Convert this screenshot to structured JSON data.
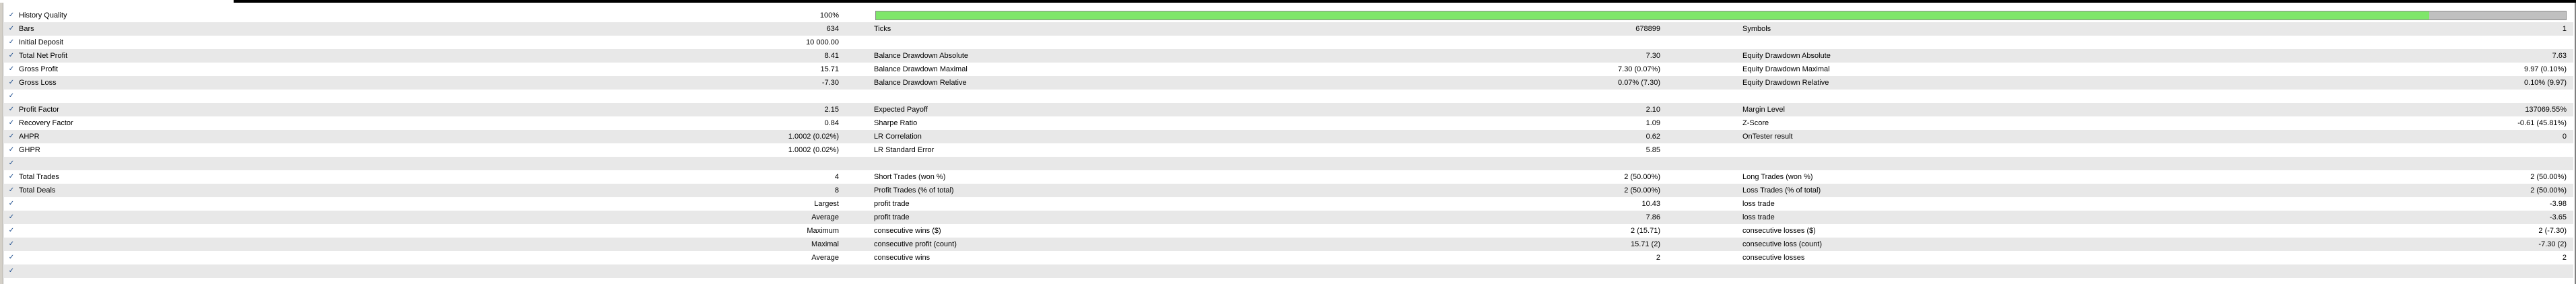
{
  "colors": {
    "progress_fill": "#7fe66a",
    "progress_bg": "#c0c0c0",
    "row_alt": "#e8e8e8",
    "check": "#1a4b8c"
  },
  "icons": {
    "row_check": "check-icon"
  },
  "history_quality": {
    "progress": 0.919
  },
  "rows": [
    {
      "c1l": "History Quality",
      "c1r": "100%",
      "c2l": "",
      "c2r": "",
      "c3l": "",
      "c3r": ""
    },
    {
      "c1l": "Bars",
      "c1r": "634",
      "c2l": "Ticks",
      "c2r": "678899",
      "c3l": "Symbols",
      "c3r": "1"
    },
    {
      "c1l": "Initial Deposit",
      "c1r": "10 000.00",
      "c2l": "",
      "c2r": "",
      "c3l": "",
      "c3r": ""
    },
    {
      "c1l": "Total Net Profit",
      "c1r": "8.41",
      "c2l": "Balance Drawdown Absolute",
      "c2r": "7.30",
      "c3l": "Equity Drawdown Absolute",
      "c3r": "7.63"
    },
    {
      "c1l": "Gross Profit",
      "c1r": "15.71",
      "c2l": "Balance Drawdown Maximal",
      "c2r": "7.30 (0.07%)",
      "c3l": "Equity Drawdown Maximal",
      "c3r": "9.97 (0.10%)"
    },
    {
      "c1l": "Gross Loss",
      "c1r": "-7.30",
      "c2l": "Balance Drawdown Relative",
      "c2r": "0.07% (7.30)",
      "c3l": "Equity Drawdown Relative",
      "c3r": "0.10% (9.97)"
    },
    {
      "c1l": "",
      "c1r": "",
      "c2l": "",
      "c2r": "",
      "c3l": "",
      "c3r": ""
    },
    {
      "c1l": "Profit Factor",
      "c1r": "2.15",
      "c2l": "Expected Payoff",
      "c2r": "2.10",
      "c3l": "Margin Level",
      "c3r": "137069.55%"
    },
    {
      "c1l": "Recovery Factor",
      "c1r": "0.84",
      "c2l": "Sharpe Ratio",
      "c2r": "1.09",
      "c3l": "Z-Score",
      "c3r": "-0.61 (45.81%)"
    },
    {
      "c1l": "AHPR",
      "c1r": "1.0002 (0.02%)",
      "c2l": "LR Correlation",
      "c2r": "0.62",
      "c3l": "OnTester result",
      "c3r": "0"
    },
    {
      "c1l": "GHPR",
      "c1r": "1.0002 (0.02%)",
      "c2l": "LR Standard Error",
      "c2r": "5.85",
      "c3l": "",
      "c3r": ""
    },
    {
      "c1l": "",
      "c1r": "",
      "c2l": "",
      "c2r": "",
      "c3l": "",
      "c3r": ""
    },
    {
      "c1l": "Total Trades",
      "c1r": "4",
      "c2l": "Short Trades (won %)",
      "c2r": "2 (50.00%)",
      "c3l": "Long Trades (won %)",
      "c3r": "2 (50.00%)"
    },
    {
      "c1l": "Total Deals",
      "c1r": "8",
      "c2l": "Profit Trades (% of total)",
      "c2r": "2 (50.00%)",
      "c3l": "Loss Trades (% of total)",
      "c3r": "2 (50.00%)"
    },
    {
      "c1l": "",
      "c1r": "Largest",
      "c2l": "profit trade",
      "c2r": "10.43",
      "c3l": "loss trade",
      "c3r": "-3.98"
    },
    {
      "c1l": "",
      "c1r": "Average",
      "c2l": "profit trade",
      "c2r": "7.86",
      "c3l": "loss trade",
      "c3r": "-3.65"
    },
    {
      "c1l": "",
      "c1r": "Maximum",
      "c2l": "consecutive wins ($)",
      "c2r": "2 (15.71)",
      "c3l": "consecutive losses ($)",
      "c3r": "2 (-7.30)"
    },
    {
      "c1l": "",
      "c1r": "Maximal",
      "c2l": "consecutive profit (count)",
      "c2r": "15.71 (2)",
      "c3l": "consecutive loss (count)",
      "c3r": "-7.30 (2)"
    },
    {
      "c1l": "",
      "c1r": "Average",
      "c2l": "consecutive wins",
      "c2r": "2",
      "c3l": "consecutive losses",
      "c3r": "2"
    },
    {
      "c1l": "",
      "c1r": "",
      "c2l": "",
      "c2r": "",
      "c3l": "",
      "c3r": ""
    }
  ]
}
